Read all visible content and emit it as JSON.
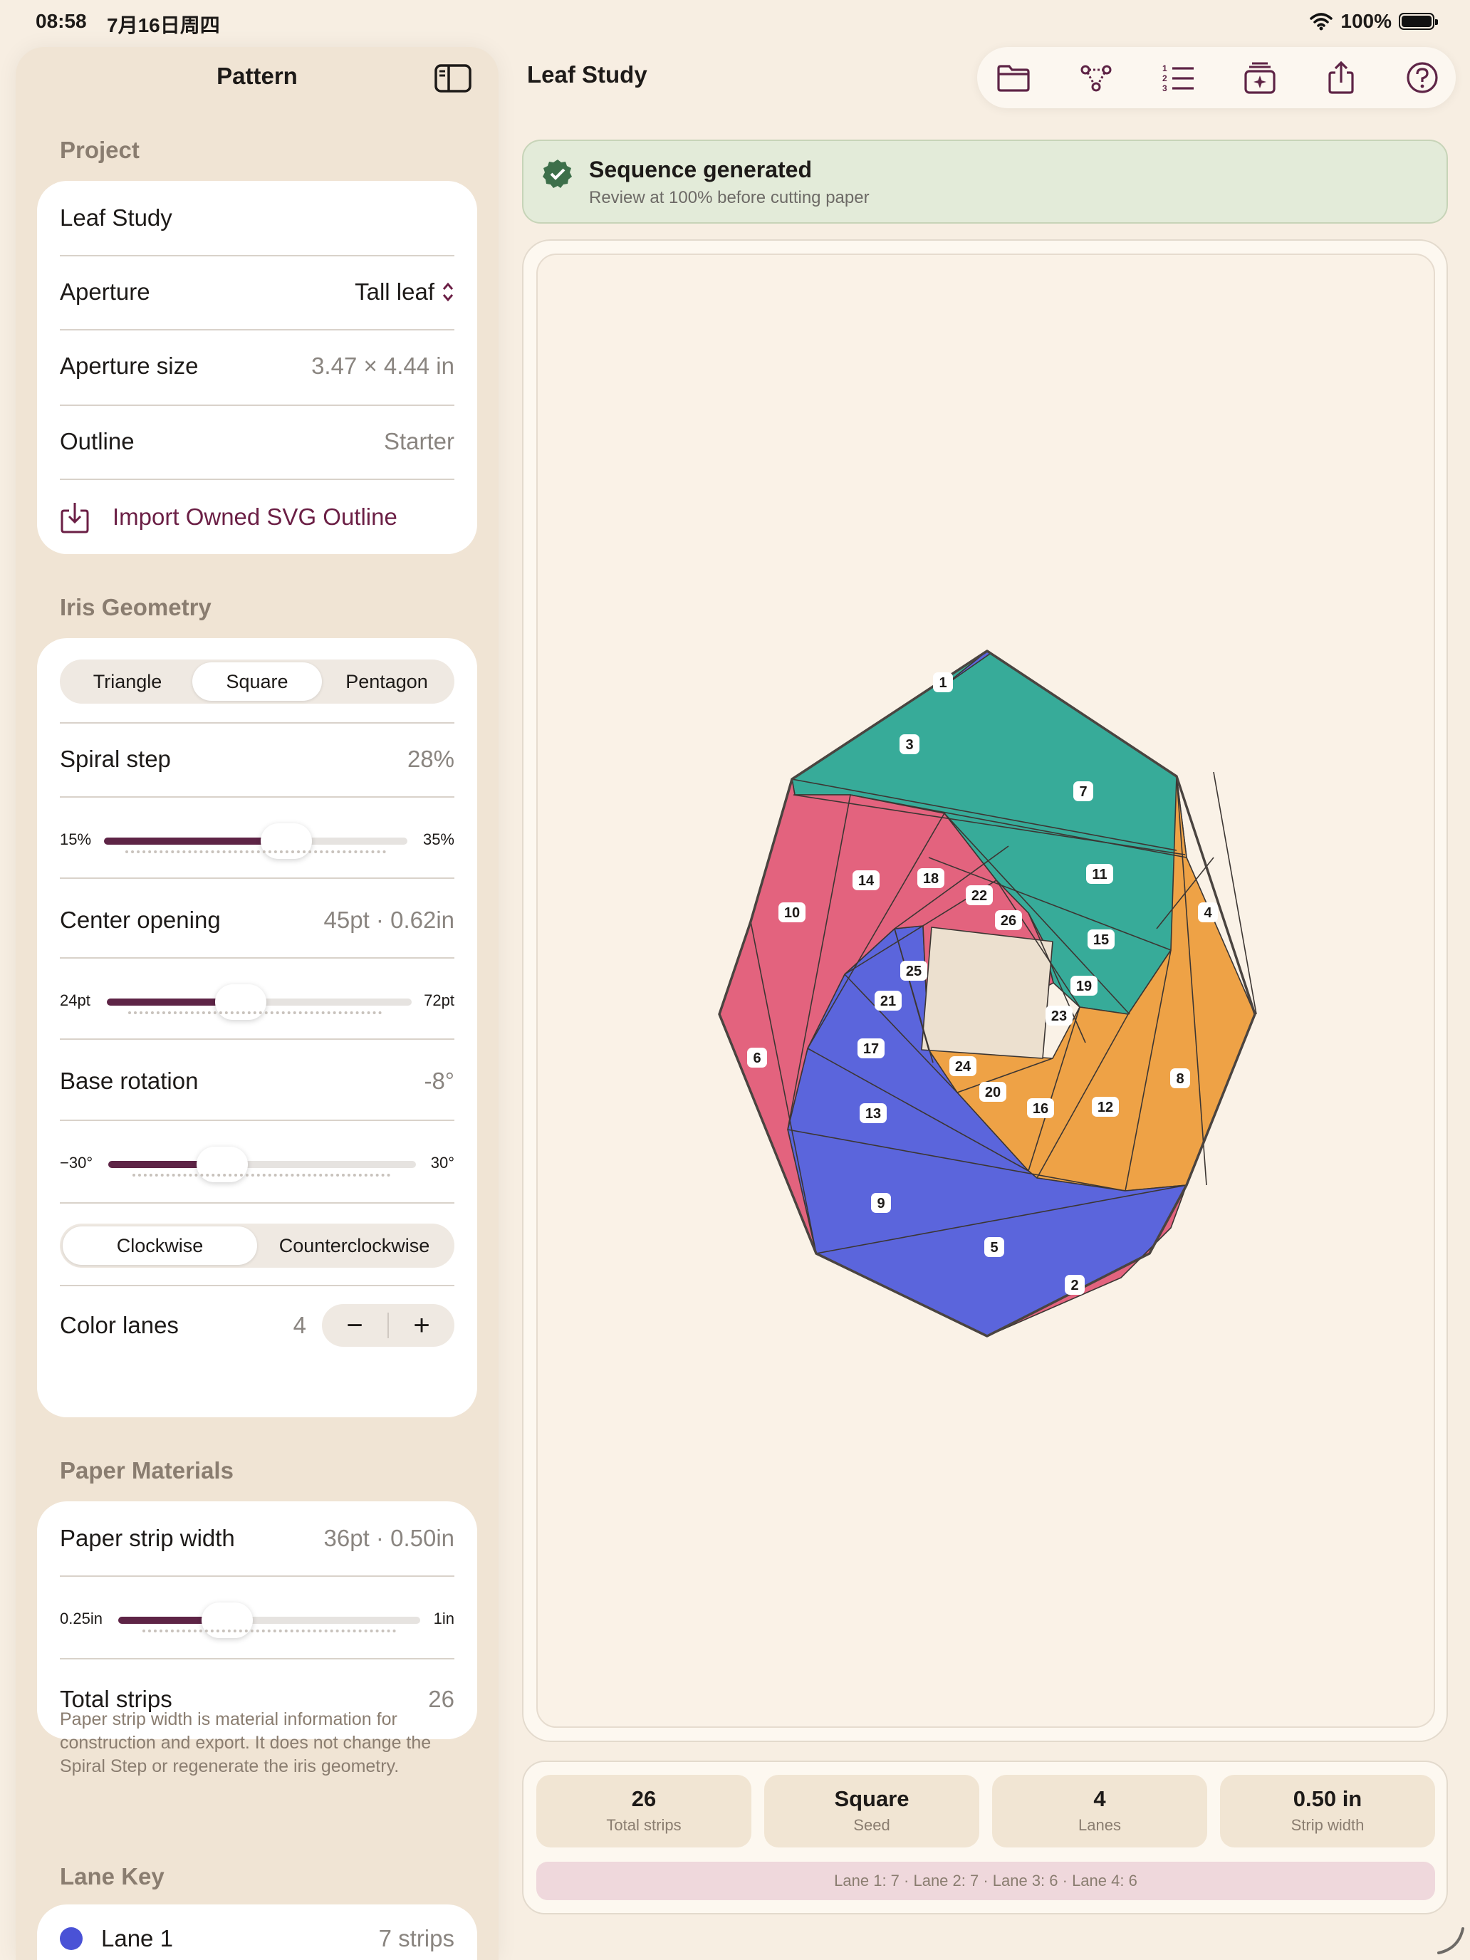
{
  "status": {
    "time": "08:58",
    "date": "7月16日周四",
    "battery": "100%"
  },
  "sidebar": {
    "title": "Pattern",
    "project": {
      "header": "Project",
      "name": "Leaf Study",
      "aperture_label": "Aperture",
      "aperture_value": "Tall leaf",
      "size_label": "Aperture size",
      "size_value": "3.47 × 4.44 in",
      "outline_label": "Outline",
      "outline_value": "Starter",
      "import_label": "Import Owned SVG Outline"
    },
    "geometry": {
      "header": "Iris Geometry",
      "shapes": [
        "Triangle",
        "Square",
        "Pentagon"
      ],
      "selected_shape": "Square",
      "spiral_label": "Spiral step",
      "spiral_value": "28%",
      "spiral_min": "15%",
      "spiral_max": "35%",
      "spiral_fraction": 0.6,
      "center_label": "Center opening",
      "center_value": "45pt · 0.62in",
      "center_min": "24pt",
      "center_max": "72pt",
      "center_fraction": 0.44,
      "rotation_label": "Base rotation",
      "rotation_value": "-8°",
      "rotation_min": "−30°",
      "rotation_max": "30°",
      "rotation_fraction": 0.37,
      "directions": [
        "Clockwise",
        "Counterclockwise"
      ],
      "selected_direction": "Clockwise",
      "lanes_label": "Color lanes",
      "lanes_value": "4",
      "minus": "−",
      "plus": "+"
    },
    "paper": {
      "header": "Paper Materials",
      "width_label": "Paper strip width",
      "width_value": "36pt · 0.50in",
      "width_min": "0.25in",
      "width_max": "1in",
      "width_fraction": 0.36,
      "total_label": "Total strips",
      "total_value": "26",
      "note": "Paper strip width is material information for construction and export. It does not change the Spiral Step or regenerate the iris geometry."
    },
    "lane_key": {
      "header": "Lane Key",
      "lane1_label": "Lane 1",
      "lane1_value": "7 strips",
      "lane1_color": "#4a52d6"
    }
  },
  "main": {
    "title": "Leaf Study",
    "toolbar_icons": [
      "folder-icon",
      "nodes-icon",
      "numbered-list-icon",
      "sparkle-stack-icon",
      "share-icon",
      "help-icon"
    ],
    "banner": {
      "title": "Sequence generated",
      "subtitle": "Review at 100% before cutting paper"
    },
    "lane_colors": {
      "blue": "#5b65dc",
      "teal": "#37ab99",
      "pink": "#e3637e",
      "orange": "#eea246",
      "center": "#ece0cf"
    },
    "strip_labels": [
      "1",
      "2",
      "3",
      "4",
      "5",
      "6",
      "7",
      "8",
      "9",
      "10",
      "11",
      "12",
      "13",
      "14",
      "15",
      "16",
      "17",
      "18",
      "19",
      "20",
      "21",
      "22",
      "23",
      "24",
      "25",
      "26"
    ],
    "summary": {
      "stats": [
        {
          "value": "26",
          "caption": "Total strips"
        },
        {
          "value": "Square",
          "caption": "Seed"
        },
        {
          "value": "4",
          "caption": "Lanes"
        },
        {
          "value": "0.50 in",
          "caption": "Strip width"
        }
      ],
      "lanes_text": "Lane 1: 7 · Lane 2: 7 · Lane 3: 6 · Lane 4: 6"
    }
  }
}
